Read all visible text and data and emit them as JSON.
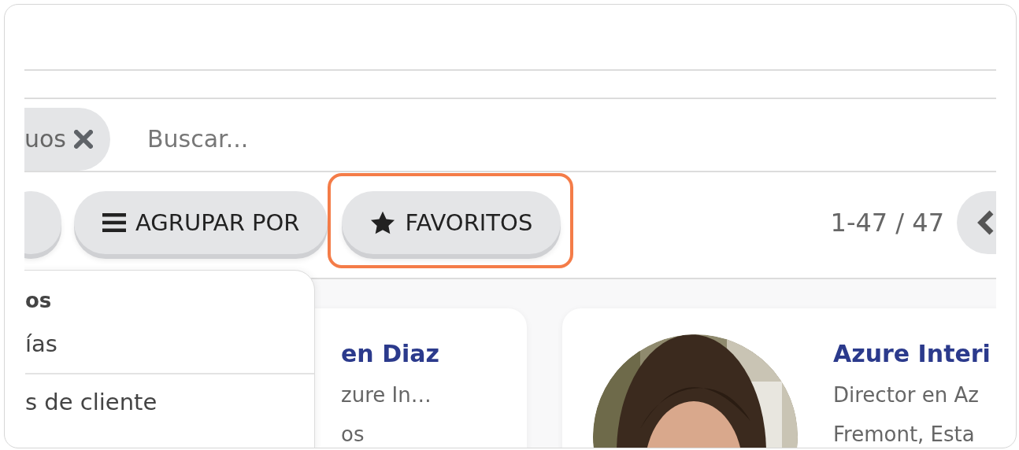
{
  "search": {
    "facets": [
      {
        "label": "uos"
      }
    ],
    "placeholder": "Buscar..."
  },
  "toolbar": {
    "buttons": [
      {
        "label": "AGRUPAR POR",
        "kind": "group",
        "highlighted": false
      },
      {
        "label": "FAVORITOS",
        "kind": "favorites",
        "highlighted": true
      }
    ],
    "pager": "1-47 / 47"
  },
  "dropdown": {
    "sections": [
      {
        "header": "os",
        "items": [
          "ías"
        ]
      },
      {
        "items": [
          "s de cliente"
        ]
      }
    ]
  },
  "cards": [
    {
      "name": "en Diaz",
      "subtitle": "zure In…",
      "detail": "os"
    },
    {
      "name": "Azure Interi",
      "subtitle": "Director en Az",
      "detail": "Fremont, Esta"
    }
  ]
}
